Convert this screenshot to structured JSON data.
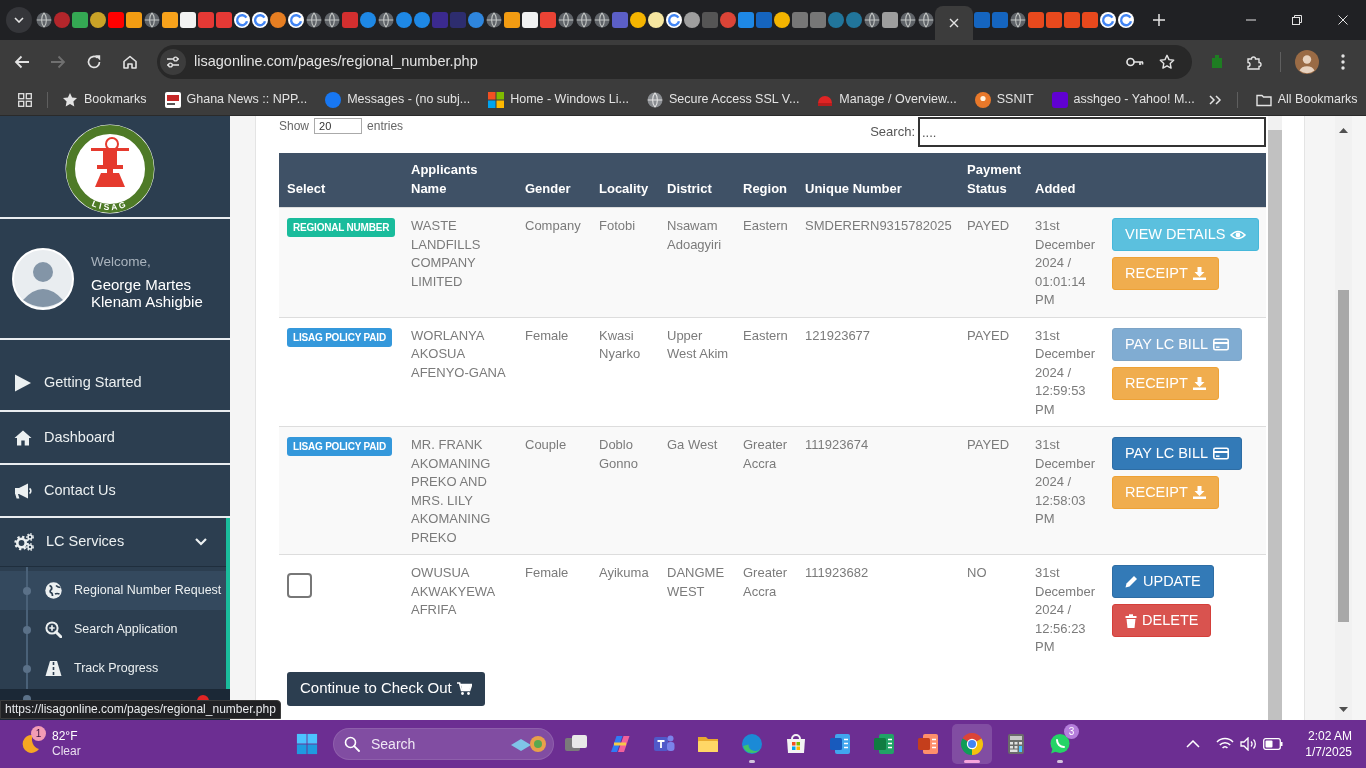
{
  "browser": {
    "tabs": [
      {
        "selected": false,
        "kind": "globe"
      },
      {
        "selected": false,
        "kind": "disc",
        "color": "#b3262b"
      },
      {
        "selected": false,
        "kind": "tile",
        "color": "#34a853"
      },
      {
        "selected": false,
        "kind": "disc",
        "color": "#c9a227"
      },
      {
        "selected": false,
        "kind": "tile",
        "color": "#ff0000"
      },
      {
        "selected": false,
        "kind": "tile",
        "color": "#f39c12"
      },
      {
        "selected": false,
        "kind": "globe"
      },
      {
        "selected": false,
        "kind": "tile",
        "color": "#f7a21b"
      },
      {
        "selected": false,
        "kind": "tile",
        "color": "#f2f2f2"
      },
      {
        "selected": false,
        "kind": "tile",
        "color": "#e53935"
      },
      {
        "selected": false,
        "kind": "tile",
        "color": "#e53935"
      },
      {
        "selected": false,
        "kind": "ring"
      },
      {
        "selected": false,
        "kind": "ring"
      },
      {
        "selected": false,
        "kind": "disc",
        "color": "#e67e22"
      },
      {
        "selected": false,
        "kind": "ring"
      },
      {
        "selected": false,
        "kind": "globe"
      },
      {
        "selected": false,
        "kind": "globe"
      },
      {
        "selected": false,
        "kind": "tile",
        "color": "#d32f2f"
      },
      {
        "selected": false,
        "kind": "disc",
        "color": "#1e88e5"
      },
      {
        "selected": false,
        "kind": "globe"
      },
      {
        "selected": false,
        "kind": "disc",
        "color": "#1e88e5"
      },
      {
        "selected": false,
        "kind": "disc",
        "color": "#1e88e5"
      },
      {
        "selected": false,
        "kind": "tile",
        "color": "#3b2a8f"
      },
      {
        "selected": false,
        "kind": "tile",
        "color": "#2d2d6e"
      },
      {
        "selected": false,
        "kind": "disc",
        "color": "#2e86de"
      },
      {
        "selected": false,
        "kind": "globe"
      },
      {
        "selected": false,
        "kind": "tile",
        "color": "#f39c12"
      },
      {
        "selected": false,
        "kind": "tile",
        "color": "#f1f1f1"
      },
      {
        "selected": false,
        "kind": "tile",
        "color": "#ea4335"
      },
      {
        "selected": false,
        "kind": "globe"
      },
      {
        "selected": false,
        "kind": "globe"
      },
      {
        "selected": false,
        "kind": "globe"
      },
      {
        "selected": false,
        "kind": "tile",
        "color": "#5b5fc7"
      },
      {
        "selected": false,
        "kind": "disc",
        "color": "#f4b400"
      },
      {
        "selected": false,
        "kind": "disc",
        "color": "#f5e6a0"
      },
      {
        "selected": false,
        "kind": "ring"
      },
      {
        "selected": false,
        "kind": "disc",
        "color": "#9e9e9e"
      },
      {
        "selected": false,
        "kind": "tile",
        "color": "#555555"
      },
      {
        "selected": false,
        "kind": "disc",
        "color": "#db4437"
      },
      {
        "selected": false,
        "kind": "tile",
        "color": "#1e88e5"
      },
      {
        "selected": false,
        "kind": "tile",
        "color": "#1565c0"
      },
      {
        "selected": false,
        "kind": "disc",
        "color": "#f4b400"
      },
      {
        "selected": false,
        "kind": "tile",
        "color": "#777777"
      },
      {
        "selected": false,
        "kind": "tile",
        "color": "#777777"
      },
      {
        "selected": false,
        "kind": "disc",
        "color": "#21759b"
      },
      {
        "selected": false,
        "kind": "disc",
        "color": "#21759b"
      },
      {
        "selected": false,
        "kind": "globe"
      },
      {
        "selected": false,
        "kind": "tile",
        "color": "#9e9e9e"
      },
      {
        "selected": false,
        "kind": "globe"
      },
      {
        "selected": false,
        "kind": "globe"
      },
      {
        "selected": true
      },
      {
        "selected": false,
        "kind": "tile",
        "color": "#1565c0"
      },
      {
        "selected": false,
        "kind": "tile",
        "color": "#1565c0"
      },
      {
        "selected": false,
        "kind": "globe"
      },
      {
        "selected": false,
        "kind": "tile",
        "color": "#e8491d"
      },
      {
        "selected": false,
        "kind": "tile",
        "color": "#e8491d"
      },
      {
        "selected": false,
        "kind": "tile",
        "color": "#e8491d"
      },
      {
        "selected": false,
        "kind": "tile",
        "color": "#e8491d"
      },
      {
        "selected": false,
        "kind": "ring"
      },
      {
        "selected": false,
        "kind": "ring"
      }
    ],
    "address": "lisagonline.com/pages/regional_number.php",
    "bookmarks": [
      {
        "label": "Bookmarks"
      },
      {
        "label": "Ghana News :: NPP..."
      },
      {
        "label": "Messages - (no subj..."
      },
      {
        "label": "Home - Windows Li..."
      },
      {
        "label": "Secure Access SSL V..."
      },
      {
        "label": "Manage / Overview..."
      },
      {
        "label": "SSNIT"
      },
      {
        "label": "asshgeo - Yahoo! M..."
      }
    ],
    "all_bookmarks": "All Bookmarks"
  },
  "sidebar": {
    "logo_text": "LISAG",
    "welcome": "Welcome,",
    "user_name": "George Martes Klenam Ashigbie",
    "menu": [
      {
        "label": "Getting Started",
        "expanded": false
      },
      {
        "label": "Dashboard",
        "expanded": false
      },
      {
        "label": "Contact Us",
        "expanded": false
      },
      {
        "label": "LC Services",
        "expanded": true,
        "children": [
          {
            "label": "Regional Number Request",
            "selected": true
          },
          {
            "label": "Search Application",
            "selected": false
          },
          {
            "label": "Track Progress",
            "selected": false
          }
        ]
      }
    ]
  },
  "table_controls": {
    "show_label": "Show",
    "page_size": "20",
    "entries_label": "entries",
    "search_label": "Search:",
    "search_placeholder": "...."
  },
  "table": {
    "columns": [
      "Select",
      "Applicants Name",
      "Gender",
      "Locality",
      "District",
      "Region",
      "Unique Number",
      "Payment Status",
      "Added"
    ],
    "rows": [
      {
        "cells": [
          {
            "kind": "badge",
            "label": "REGIONAL NUMBER",
            "color": "#1abc9c"
          },
          "WASTE LANDFILLS COMPANY LIMITED",
          "Company",
          "Fotobi",
          "Nsawam Adoagyiri",
          "Eastern",
          "SMDERERN9315782025",
          "PAYED",
          "31st December 2024 / 01:01:14 PM"
        ],
        "actions": [
          {
            "kind": "view",
            "label": "VIEW DETAILS",
            "disabled": false
          },
          {
            "kind": "receipt",
            "label": "RECEIPT",
            "disabled": false
          }
        ]
      },
      {
        "cells": [
          {
            "kind": "badge",
            "label": "LISAG POLICY PAID",
            "color": "#3498db"
          },
          "WORLANYA AKOSUA AFENYO-GANA",
          "Female",
          "Kwasi Nyarko",
          "Upper West Akim",
          "Eastern",
          "121923677",
          "PAYED",
          "31st December 2024 / 12:59:53 PM"
        ],
        "actions": [
          {
            "kind": "pay",
            "label": "PAY LC BILL",
            "disabled": true
          },
          {
            "kind": "receipt",
            "label": "RECEIPT",
            "disabled": false
          }
        ]
      },
      {
        "cells": [
          {
            "kind": "badge",
            "label": "LISAG POLICY PAID",
            "color": "#3498db"
          },
          "MR. FRANK AKOMANING PREKO AND MRS. LILY AKOMANING PREKO",
          "Couple",
          "Doblo Gonno",
          "Ga West",
          "Greater Accra",
          "111923674",
          "PAYED",
          "31st December 2024 / 12:58:03 PM"
        ],
        "actions": [
          {
            "kind": "pay",
            "label": "PAY LC BILL",
            "disabled": false
          },
          {
            "kind": "receipt",
            "label": "RECEIPT",
            "disabled": false
          }
        ]
      },
      {
        "cells": [
          {
            "kind": "checkbox",
            "checked": false
          },
          "OWUSUA AKWAKYEWA AFRIFA",
          "Female",
          "Ayikuma",
          "DANGME WEST",
          "Greater Accra",
          "111923682",
          "NO",
          "31st December 2024 / 12:56:23 PM"
        ],
        "actions": [
          {
            "kind": "update",
            "label": "UPDATE",
            "disabled": false
          },
          {
            "kind": "delete",
            "label": "DELETE",
            "disabled": false
          }
        ]
      }
    ]
  },
  "checkout_button": "Continue to Check Out",
  "status_url": "https://lisagonline.com/pages/regional_number.php",
  "taskbar": {
    "weather": {
      "badge": "1",
      "temperature": "82°F",
      "condition": "Clear"
    },
    "search_placeholder": "Search",
    "apps": [
      {
        "selected": false,
        "running": false
      },
      {
        "selected": false,
        "running": false
      },
      {
        "selected": false,
        "running": false
      },
      {
        "selected": false,
        "running": false
      },
      {
        "selected": false,
        "running": true
      },
      {
        "selected": false,
        "running": false
      },
      {
        "selected": false,
        "running": false
      },
      {
        "selected": false,
        "running": false
      },
      {
        "selected": false,
        "running": false
      },
      {
        "selected": true,
        "running": true
      },
      {
        "selected": false,
        "running": false
      },
      {
        "selected": false,
        "running": true,
        "badge": "3"
      }
    ],
    "clock": {
      "time": "2:02 AM",
      "date": "1/7/2025"
    }
  }
}
